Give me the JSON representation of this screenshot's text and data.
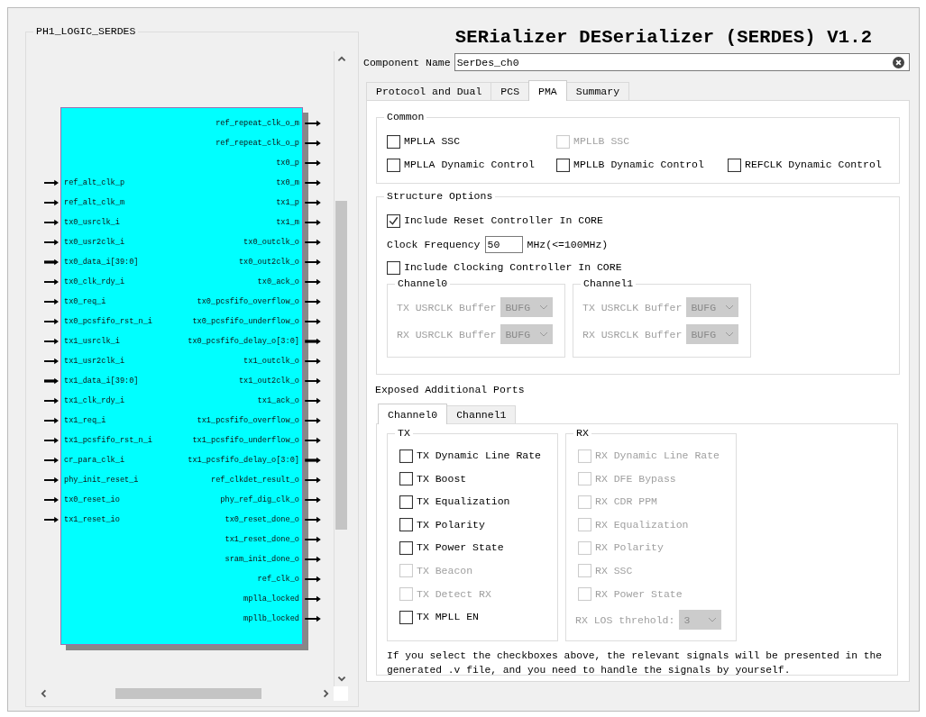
{
  "left_panel": {
    "title": "PH1_LOGIC_SERDES",
    "block": {
      "input_pins": [
        {
          "name": "ref_alt_clk_p",
          "bus": false
        },
        {
          "name": "ref_alt_clk_m",
          "bus": false
        },
        {
          "name": "tx0_usrclk_i",
          "bus": false
        },
        {
          "name": "tx0_usr2clk_i",
          "bus": false
        },
        {
          "name": "tx0_data_i[39:0]",
          "bus": true
        },
        {
          "name": "tx0_clk_rdy_i",
          "bus": false
        },
        {
          "name": "tx0_req_i",
          "bus": false
        },
        {
          "name": "tx0_pcsfifo_rst_n_i",
          "bus": false
        },
        {
          "name": "tx1_usrclk_i",
          "bus": false
        },
        {
          "name": "tx1_usr2clk_i",
          "bus": false
        },
        {
          "name": "tx1_data_i[39:0]",
          "bus": true
        },
        {
          "name": "tx1_clk_rdy_i",
          "bus": false
        },
        {
          "name": "tx1_req_i",
          "bus": false
        },
        {
          "name": "tx1_pcsfifo_rst_n_i",
          "bus": false
        },
        {
          "name": "cr_para_clk_i",
          "bus": false
        },
        {
          "name": "phy_init_reset_i",
          "bus": false
        },
        {
          "name": "tx0_reset_io",
          "bus": false
        },
        {
          "name": "tx1_reset_io",
          "bus": false
        }
      ],
      "output_pins": [
        {
          "name": "ref_repeat_clk_o_m",
          "bus": false
        },
        {
          "name": "ref_repeat_clk_o_p",
          "bus": false
        },
        {
          "name": "tx0_p",
          "bus": false
        },
        {
          "name": "tx0_m",
          "bus": false
        },
        {
          "name": "tx1_p",
          "bus": false
        },
        {
          "name": "tx1_m",
          "bus": false
        },
        {
          "name": "tx0_outclk_o",
          "bus": false
        },
        {
          "name": "tx0_out2clk_o",
          "bus": false
        },
        {
          "name": "tx0_ack_o",
          "bus": false
        },
        {
          "name": "tx0_pcsfifo_overflow_o",
          "bus": false
        },
        {
          "name": "tx0_pcsfifo_underflow_o",
          "bus": false
        },
        {
          "name": "tx0_pcsfifo_delay_o[3:0]",
          "bus": true
        },
        {
          "name": "tx1_outclk_o",
          "bus": false
        },
        {
          "name": "tx1_out2clk_o",
          "bus": false
        },
        {
          "name": "tx1_ack_o",
          "bus": false
        },
        {
          "name": "tx1_pcsfifo_overflow_o",
          "bus": false
        },
        {
          "name": "tx1_pcsfifo_underflow_o",
          "bus": false
        },
        {
          "name": "tx1_pcsfifo_delay_o[3:0]",
          "bus": true
        },
        {
          "name": "ref_clkdet_result_o",
          "bus": false
        },
        {
          "name": "phy_ref_dig_clk_o",
          "bus": false
        },
        {
          "name": "tx0_reset_done_o",
          "bus": false
        },
        {
          "name": "tx1_reset_done_o",
          "bus": false
        },
        {
          "name": "sram_init_done_o",
          "bus": false
        },
        {
          "name": "ref_clk_o",
          "bus": false
        },
        {
          "name": "mplla_locked",
          "bus": false
        },
        {
          "name": "mpllb_locked",
          "bus": false
        }
      ]
    }
  },
  "title": "SERializer DESerializer (SERDES) V1.2",
  "component_name": {
    "label": "Component Name",
    "value": "SerDes_ch0"
  },
  "tabs": [
    {
      "label": "Protocol and Dual",
      "selected": false
    },
    {
      "label": "PCS",
      "selected": false
    },
    {
      "label": "PMA",
      "selected": true
    },
    {
      "label": "Summary",
      "selected": false
    }
  ],
  "common": {
    "title": "Common",
    "rows": [
      [
        {
          "label": "MPLLA SSC",
          "checked": false,
          "disabled": false
        },
        {
          "label": "MPLLB SSC",
          "checked": false,
          "disabled": true
        }
      ],
      [
        {
          "label": "MPLLA Dynamic Control",
          "checked": false,
          "disabled": false
        },
        {
          "label": "MPLLB Dynamic Control",
          "checked": false,
          "disabled": false
        },
        {
          "label": "REFCLK Dynamic Control",
          "checked": false,
          "disabled": false
        }
      ]
    ]
  },
  "structure": {
    "title": "Structure Options",
    "items": [
      {
        "kind": "checkbox",
        "label": "Include Reset Controller In CORE",
        "checked": true,
        "disabled": false
      },
      {
        "kind": "number",
        "label": "Clock Frequency",
        "value": "50",
        "unit": "MHz(<=100MHz)"
      },
      {
        "kind": "checkbox",
        "label": "Include Clocking Controller In CORE",
        "checked": false,
        "disabled": false
      }
    ],
    "channels": [
      {
        "title": "Channel0",
        "buffers": [
          {
            "label": "TX USRCLK Buffer",
            "value": "BUFG",
            "disabled": true
          },
          {
            "label": "RX USRCLK Buffer",
            "value": "BUFG",
            "disabled": true
          }
        ]
      },
      {
        "title": "Channel1",
        "buffers": [
          {
            "label": "TX USRCLK Buffer",
            "value": "BUFG",
            "disabled": true
          },
          {
            "label": "RX USRCLK Buffer",
            "value": "BUFG",
            "disabled": true
          }
        ]
      }
    ]
  },
  "exposed": {
    "title": "Exposed Additional Ports",
    "tabs": [
      {
        "label": "Channel0",
        "selected": true
      },
      {
        "label": "Channel1",
        "selected": false
      }
    ],
    "groups": [
      {
        "title": "TX",
        "options": [
          {
            "label": "TX Dynamic Line Rate",
            "checked": false,
            "disabled": false
          },
          {
            "label": "TX Boost",
            "checked": false,
            "disabled": false
          },
          {
            "label": "TX Equalization",
            "checked": false,
            "disabled": false
          },
          {
            "label": "TX Polarity",
            "checked": false,
            "disabled": false
          },
          {
            "label": "TX Power State",
            "checked": false,
            "disabled": false
          },
          {
            "label": "TX Beacon",
            "checked": false,
            "disabled": true
          },
          {
            "label": "TX Detect RX",
            "checked": false,
            "disabled": true
          },
          {
            "label": "TX MPLL EN",
            "checked": false,
            "disabled": false
          }
        ]
      },
      {
        "title": "RX",
        "options": [
          {
            "label": "RX Dynamic Line Rate",
            "checked": false,
            "disabled": true
          },
          {
            "label": "RX DFE Bypass",
            "checked": false,
            "disabled": true
          },
          {
            "label": "RX CDR PPM",
            "checked": false,
            "disabled": true
          },
          {
            "label": "RX Equalization",
            "checked": false,
            "disabled": true
          },
          {
            "label": "RX Polarity",
            "checked": false,
            "disabled": true
          },
          {
            "label": "RX SSC",
            "checked": false,
            "disabled": true
          },
          {
            "label": "RX Power State",
            "checked": false,
            "disabled": true
          }
        ],
        "threshold": {
          "label": "RX LOS threhold:",
          "value": "3",
          "disabled": true
        }
      }
    ],
    "note": "If you select the checkboxes above, the relevant signals will be presented in the generated .v file, and you need to handle the signals by yourself."
  }
}
